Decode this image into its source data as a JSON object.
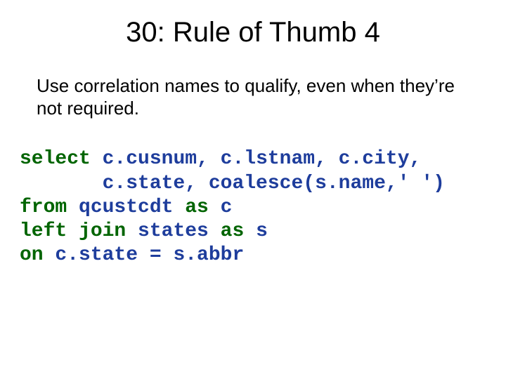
{
  "title": "30: Rule of Thumb 4",
  "subtitle": "Use correlation names to qualify, even when they’re not required.",
  "code": {
    "kw_select": "select",
    "l1_rest": " c.cusnum, c.lstnam, c.city,",
    "l2": "       c.state, coalesce(s.name,' ')",
    "kw_from": "from",
    "l3_mid": " qcustcdt ",
    "kw_as1": "as",
    "l3_end": " c",
    "kw_leftjoin": "left join",
    "l4_mid": " states ",
    "kw_as2": "as",
    "l4_end": " s",
    "kw_on": "on",
    "l5_rest": " c.state = s.abbr"
  }
}
